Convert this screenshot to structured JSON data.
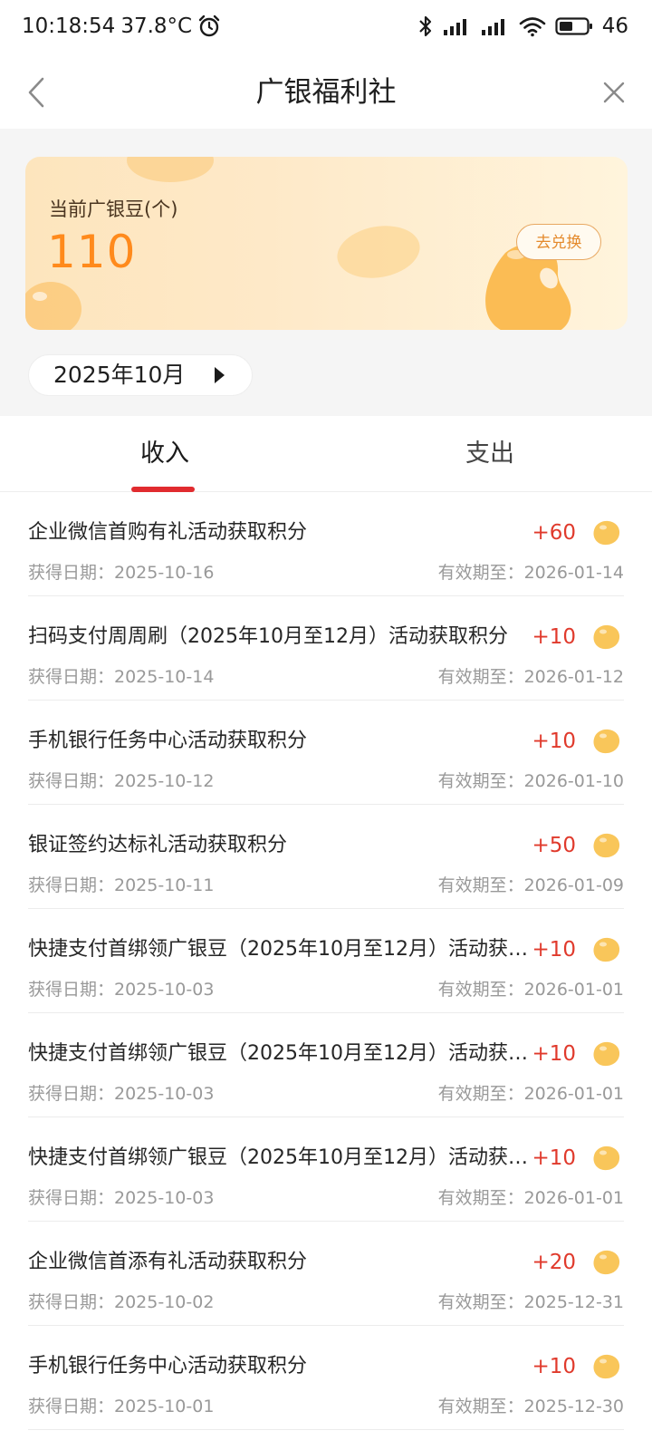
{
  "status_bar": {
    "time": "10:18:54",
    "temperature": "37.8°C",
    "battery": "46",
    "icons": [
      "alarm-icon",
      "bluetooth-icon",
      "signal-icon",
      "signal-icon",
      "wifi-icon",
      "battery-icon"
    ]
  },
  "nav": {
    "title": "广银福利社",
    "back_icon": "chevron-left-icon",
    "close_icon": "close-icon"
  },
  "bean_card": {
    "label": "当前广银豆(个)",
    "value": "110",
    "exchange_label": "去兑换"
  },
  "month_selector": {
    "value": "2025年10月",
    "arrow_icon": "caret-right-icon"
  },
  "tabs": [
    {
      "label": "收入",
      "active": true
    },
    {
      "label": "支出",
      "active": false
    }
  ],
  "colors": {
    "accent_red": "#e12b2f",
    "amount_red": "#e03a2c",
    "bean_orange": "#ff8a1c",
    "card_gradient_start": "#fde5bd",
    "card_gradient_end": "#fff4dc"
  },
  "records": [
    {
      "title": "企业微信首购有礼活动获取积分",
      "amount": "+60",
      "date": "获得日期：2025-10-16",
      "expiry": "有效期至：2026-01-14"
    },
    {
      "title": "扫码支付周周刷（2025年10月至12月）活动获取积分",
      "amount": "+10",
      "date": "获得日期：2025-10-14",
      "expiry": "有效期至：2026-01-12"
    },
    {
      "title": "手机银行任务中心活动获取积分",
      "amount": "+10",
      "date": "获得日期：2025-10-12",
      "expiry": "有效期至：2026-01-10"
    },
    {
      "title": "银证签约达标礼活动获取积分",
      "amount": "+50",
      "date": "获得日期：2025-10-11",
      "expiry": "有效期至：2026-01-09"
    },
    {
      "title": "快捷支付首绑领广银豆（2025年10月至12月）活动获…",
      "amount": "+10",
      "date": "获得日期：2025-10-03",
      "expiry": "有效期至：2026-01-01"
    },
    {
      "title": "快捷支付首绑领广银豆（2025年10月至12月）活动获…",
      "amount": "+10",
      "date": "获得日期：2025-10-03",
      "expiry": "有效期至：2026-01-01"
    },
    {
      "title": "快捷支付首绑领广银豆（2025年10月至12月）活动获…",
      "amount": "+10",
      "date": "获得日期：2025-10-03",
      "expiry": "有效期至：2026-01-01"
    },
    {
      "title": "企业微信首添有礼活动获取积分",
      "amount": "+20",
      "date": "获得日期：2025-10-02",
      "expiry": "有效期至：2025-12-31"
    },
    {
      "title": "手机银行任务中心活动获取积分",
      "amount": "+10",
      "date": "获得日期：2025-10-01",
      "expiry": "有效期至：2025-12-30"
    }
  ]
}
